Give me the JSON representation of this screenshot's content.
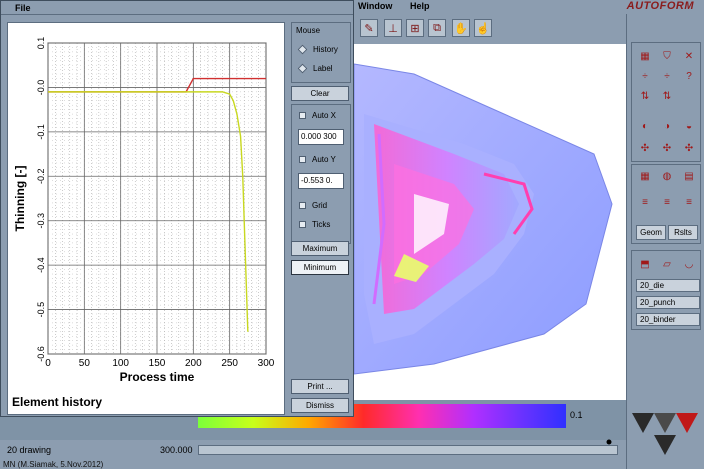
{
  "app": {
    "menu": [
      "Window",
      "Help"
    ],
    "logo": "AUTOFORM"
  },
  "dialog": {
    "menu_file": "File",
    "mouse_group_label": "Mouse",
    "mouse_options": [
      "History",
      "Label"
    ],
    "clear_button": "Clear",
    "auto_x_label": "Auto X",
    "auto_x_value": "0.000 300",
    "auto_y_label": "Auto Y",
    "auto_y_value": "-0.553 0.",
    "grid_label": "Grid",
    "ticks_label": "Ticks",
    "maximum_button": "Maximum",
    "minimum_button": "Minimum",
    "print_button": "Print ...",
    "dismiss_button": "Dismiss",
    "plot_caption": "Element history"
  },
  "right_panel": {
    "tool_buttons": [
      "Geom",
      "Rslts"
    ],
    "objects": [
      "20_die",
      "20_punch",
      "20_binder"
    ]
  },
  "colorbar_max_label": "0.1",
  "bottom": {
    "file_label": "20 drawing",
    "value_label": "300.000",
    "status": "MN (M.Siamak, 5.Nov.2012)"
  },
  "chart_data": {
    "type": "line",
    "xlabel": "Process time",
    "ylabel": "Thinning  [-]",
    "xlim": [
      0,
      300
    ],
    "ylim": [
      -0.6,
      0.1
    ],
    "x_ticks": [
      0,
      50,
      100,
      150,
      200,
      250,
      300
    ],
    "y_ticks": [
      0.1,
      0.0,
      -0.1,
      -0.2,
      -0.3,
      -0.4,
      -0.5,
      -0.6
    ],
    "y_tick_labels": [
      "0.1",
      "-0.0",
      "-0.1",
      "-0.2",
      "-0.3",
      "-0.4",
      "-0.5",
      "-0.6"
    ],
    "grid": true,
    "series": [
      {
        "color": "#d03030",
        "x": [
          0,
          190,
          200,
          250,
          300
        ],
        "y": [
          -0.01,
          -0.01,
          0.02,
          0.02,
          0.02
        ]
      },
      {
        "color": "#c8d820",
        "x": [
          0,
          190,
          200,
          240,
          250,
          255,
          260,
          265,
          268,
          270,
          272,
          274,
          275
        ],
        "y": [
          -0.01,
          -0.01,
          -0.01,
          -0.01,
          -0.015,
          -0.03,
          -0.06,
          -0.11,
          -0.2,
          -0.3,
          -0.4,
          -0.5,
          -0.55
        ]
      }
    ]
  }
}
